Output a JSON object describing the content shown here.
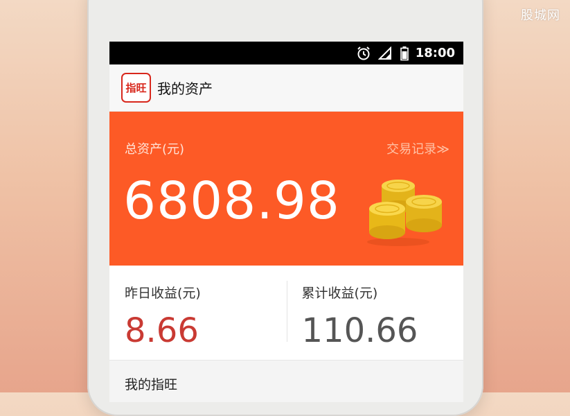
{
  "watermark": "股城网",
  "status_bar": {
    "time": "18:00",
    "icons": [
      "alarm-icon",
      "signal-icon",
      "battery-icon"
    ]
  },
  "app_bar": {
    "logo_text": "指旺",
    "title": "我的资产"
  },
  "hero": {
    "total_label": "总资产(元)",
    "transactions_link": "交易记录≫",
    "total_amount": "6808.98",
    "background": "#fd5a26"
  },
  "earnings": {
    "yesterday_label": "昨日收益(元)",
    "yesterday_value": "8.66",
    "total_label": "累计收益(元)",
    "total_value": "110.66",
    "yesterday_color": "#c93a33"
  },
  "section": {
    "title": "我的指旺"
  }
}
